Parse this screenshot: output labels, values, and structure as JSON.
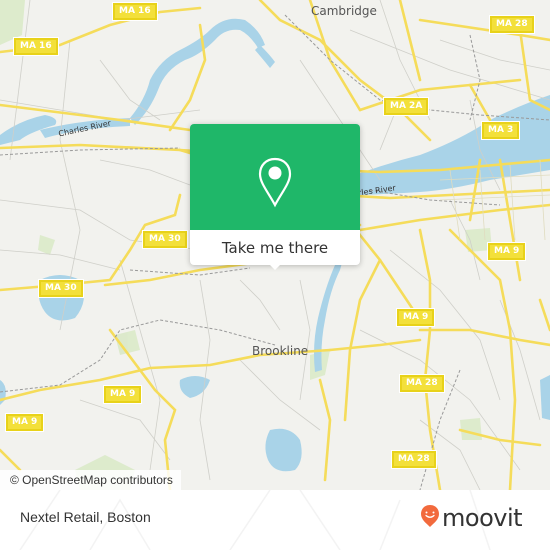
{
  "map": {
    "place_labels": [
      {
        "id": "cambridge",
        "text": "Cambridge"
      },
      {
        "id": "brookline",
        "text": "Brookline"
      }
    ],
    "water_labels": [
      {
        "id": "charles-river-west",
        "text": "Charles River"
      },
      {
        "id": "charles-river-east",
        "text": "rles River"
      }
    ],
    "route_shields": [
      {
        "text": "MA 16"
      },
      {
        "text": "MA 16"
      },
      {
        "text": "MA 28"
      },
      {
        "text": "MA 2A"
      },
      {
        "text": "MA 3"
      },
      {
        "text": "MA 30"
      },
      {
        "text": "MA 30"
      },
      {
        "text": "MA 9"
      },
      {
        "text": "MA 9"
      },
      {
        "text": "MA 9"
      },
      {
        "text": "MA 9"
      },
      {
        "text": "MA 28"
      },
      {
        "text": "MA 28"
      }
    ],
    "attribution": "© OpenStreetMap contributors"
  },
  "popup": {
    "icon": "location-pin-icon",
    "button_label": "Take me there",
    "color": "#1fb769"
  },
  "footer": {
    "place_title": "Nextel Retail, Boston",
    "brand": "moovit",
    "brand_color": "#f26a3d"
  }
}
